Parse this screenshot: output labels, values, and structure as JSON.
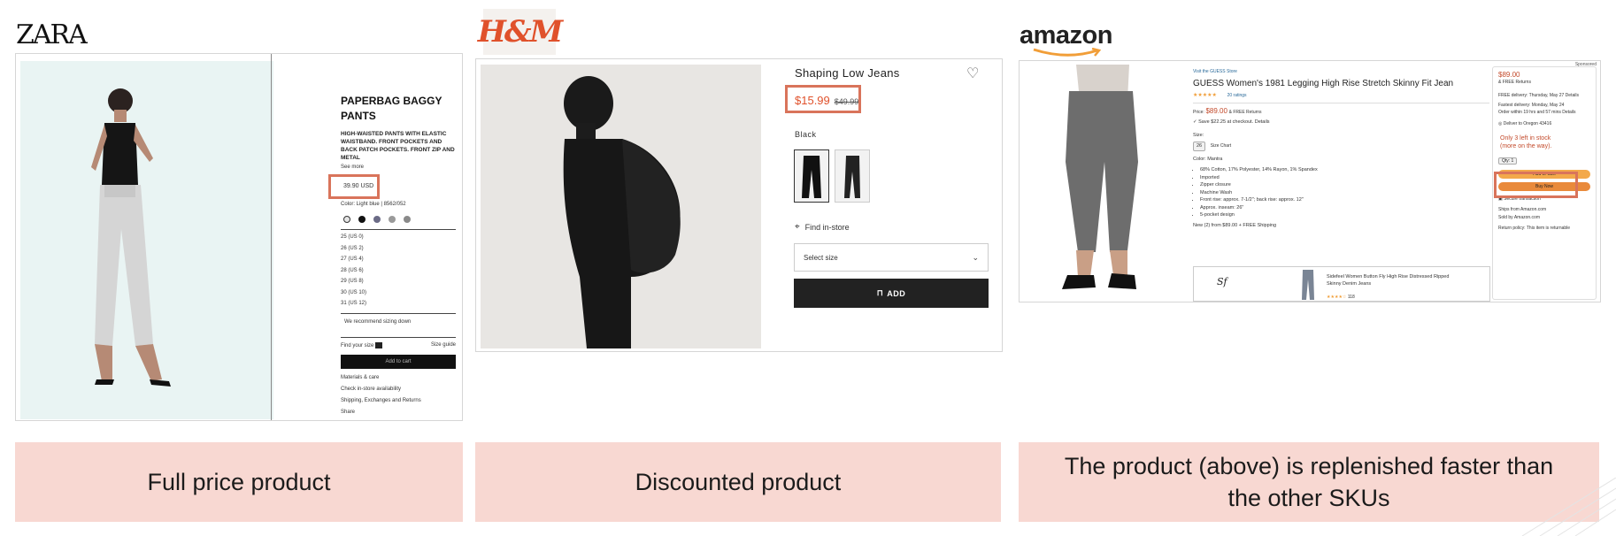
{
  "zara": {
    "logo": "ZARA",
    "product_title": "PAPERBAG BAGGY PANTS",
    "description": "HIGH-WAISTED PANTS WITH ELASTIC WAISTBAND. FRONT POCKETS AND BACK PATCH POCKETS. FRONT ZIP AND METAL",
    "see_more": "See more",
    "price": "39.90 USD",
    "color_label": "Color: Light blue | 8562/052",
    "swatch_colors": [
      "#e5e5e5",
      "#111111",
      "#6b6b86",
      "#9a9a9a",
      "#8a8a8a"
    ],
    "sizes": [
      "25 (US 0)",
      "26 (US 2)",
      "27 (US 4)",
      "28 (US 6)",
      "29 (US 8)",
      "30 (US 10)",
      "31 (US 12)"
    ],
    "sizing_note": "We recommend sizing down",
    "find_size": "Find your size",
    "size_guide": "Size guide",
    "add_to_cart": "Add to cart",
    "links": [
      "Materials & care",
      "Check in-store availability",
      "Shipping, Exchanges and Returns",
      "Share"
    ],
    "caption": "Full price product"
  },
  "hm": {
    "logo": "H&M",
    "product_title": "Shaping Low Jeans",
    "price": "$15.99",
    "old_price": "$49.99",
    "color": "Black",
    "find_in_store": "Find in-store",
    "select_size": "Select size",
    "add": "ADD",
    "caption": "Discounted product"
  },
  "amazon": {
    "logo": "amazon",
    "sponsored": "Sponsored",
    "store_link": "Visit the GUESS Store",
    "product_title": "GUESS Women's 1981 Legging High Rise Stretch Skinny Fit Jean",
    "ratings": "20 ratings",
    "price_label": "Price:",
    "price": "$89.00",
    "free_returns": "& FREE Returns",
    "save_note": "Save $22.25 at checkout. Details",
    "size_label": "Size:",
    "size_value": "26",
    "size_chart": "Size Chart",
    "color_label": "Color: Mantra",
    "bullets": [
      "68% Cotton, 17% Polyester, 14% Rayon, 1% Spandex",
      "Imported",
      "Zipper closure",
      "Machine Wash",
      "Front rise: approx. 7-1/2\"; back rise: approx. 12\"",
      "Approx. inseam: 26\"",
      "5-pocket design"
    ],
    "new_from": "New (2) from $89.00 + FREE Shipping",
    "ad_title": "Sidefeel Women Button Fly High Rise Distressed Ripped Skinny Denim Jeans",
    "ad_count": "118",
    "buybox_price": "$89.00",
    "buybox_returns": "& FREE Returns",
    "free_delivery": "FREE delivery: Thursday, May 27 Details",
    "fastest_delivery": "Fastest delivery: Monday, May 24",
    "order_within": "Order within 19 hrs and 57 mins Details",
    "deliver_to": "Deliver to Oregon 43416",
    "stock_line1": "Only 3 left in stock",
    "stock_line2": "(more on the way).",
    "qty": "Qty: 1",
    "add_to_cart": "Add to Cart",
    "buy_now": "Buy Now",
    "secure": "Secure transaction",
    "ships_from_label": "Ships from",
    "ships_from": "Amazon.com",
    "sold_by_label": "Sold by",
    "sold_by": "Amazon.com",
    "return_policy": "Return policy: This item is returnable",
    "caption": "The product (above) is replenished faster than the other SKUs"
  },
  "colors": {
    "caption_bg": "#f8d8d2",
    "highlight": "#d9745b",
    "hm_red": "#e0512b",
    "amazon_orange": "#f19e38"
  }
}
